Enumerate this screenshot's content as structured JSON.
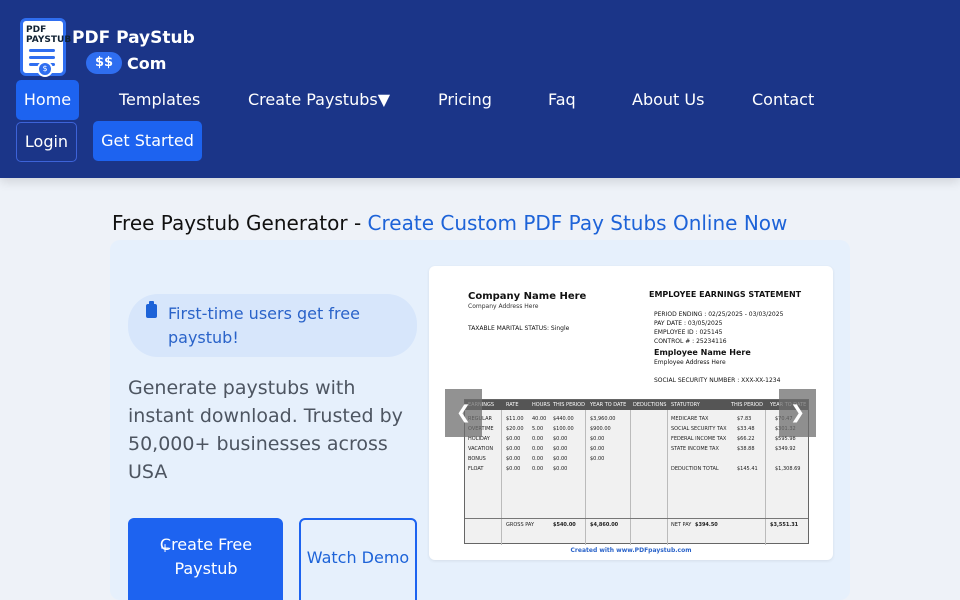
{
  "header": {
    "logo": {
      "doc_label": "PDF\nPAYSTUB",
      "title": "PDF PayStub",
      "dollar": "$$",
      "com": "Com",
      "coin": "$"
    },
    "nav": [
      {
        "label": "Home"
      },
      {
        "label": "Templates"
      },
      {
        "label": "Create Paystubs▼"
      },
      {
        "label": "Pricing"
      },
      {
        "label": "Faq"
      },
      {
        "label": "About Us"
      },
      {
        "label": "Contact"
      }
    ],
    "login": "Login",
    "get_started": "Get Started"
  },
  "hero": {
    "title_prefix": "Free Paystub Generator - ",
    "title_accent": "Create Custom PDF Pay Stubs Online Now",
    "badge": "First-time users get free paystub!",
    "description": "Generate paystubs with instant download. Trusted by 50,000+ businesses across USA",
    "create_button": {
      "plus": "+",
      "label": "Create Free Paystub"
    },
    "watch_button": "Watch Demo"
  },
  "carousel": {
    "prev": "❮",
    "next": "❯",
    "stub": {
      "company": "Company Name Here",
      "company_address": "Company Address Here",
      "marital_status": "TAXABLE MARITAL STATUS:  Single",
      "statement_title": "EMPLOYEE EARNINGS STATEMENT",
      "period_ending": "PERIOD ENDING : 02/25/2025 - 03/03/2025",
      "pay_date": "PAY DATE :  03/05/2025",
      "employee_id": "EMPLOYEE ID :  025145",
      "control": "CONTROL # :  25234116",
      "employee_name": "Employee Name Here",
      "employee_address": "Employee Address Here",
      "ssn": "SOCIAL SECURITY NUMBER :  XXX-XX-1234",
      "headers": [
        "EARNINGS",
        "RATE",
        "HOURS",
        "THIS PERIOD",
        "YEAR TO DATE",
        "DEDUCTIONS",
        "STATUTORY",
        "THIS PERIOD",
        "YEAR TO DATE"
      ],
      "earnings": [
        {
          "name": "REGULAR",
          "rate": "$11.00",
          "hours": "40.00",
          "period": "$440.00",
          "ytd": "$3,960.00"
        },
        {
          "name": "OVERTIME",
          "rate": "$20.00",
          "hours": "5.00",
          "period": "$100.00",
          "ytd": "$900.00"
        },
        {
          "name": "HOLIDAY",
          "rate": "$0.00",
          "hours": "0.00",
          "period": "$0.00",
          "ytd": "$0.00"
        },
        {
          "name": "VACATION",
          "rate": "$0.00",
          "hours": "0.00",
          "period": "$0.00",
          "ytd": "$0.00"
        },
        {
          "name": "BONUS",
          "rate": "$0.00",
          "hours": "0.00",
          "period": "$0.00",
          "ytd": "$0.00"
        },
        {
          "name": "FLOAT",
          "rate": "$0.00",
          "hours": "0.00",
          "period": "$0.00",
          "ytd": ""
        }
      ],
      "statutory": [
        {
          "name": "MEDICARE TAX",
          "period": "$7.83",
          "ytd": "$70.47"
        },
        {
          "name": "SOCIAL SECURITY TAX",
          "period": "$33.48",
          "ytd": "$301.32"
        },
        {
          "name": "FEDERAL INCOME TAX",
          "period": "$66.22",
          "ytd": "$595.98"
        },
        {
          "name": "STATE INCOME TAX",
          "period": "$38.88",
          "ytd": "$349.92"
        },
        {
          "name": "DEDUCTION TOTAL",
          "period": "$145.41",
          "ytd": "$1,308.69"
        }
      ],
      "gross_label": "GROSS PAY",
      "gross_period": "$540.00",
      "gross_ytd": "$4,860.00",
      "net_label": "NET PAY",
      "net_period": "$394.50",
      "net_ytd": "$3,551.31",
      "footer": "Created with www.PDFpaystub.com"
    }
  }
}
